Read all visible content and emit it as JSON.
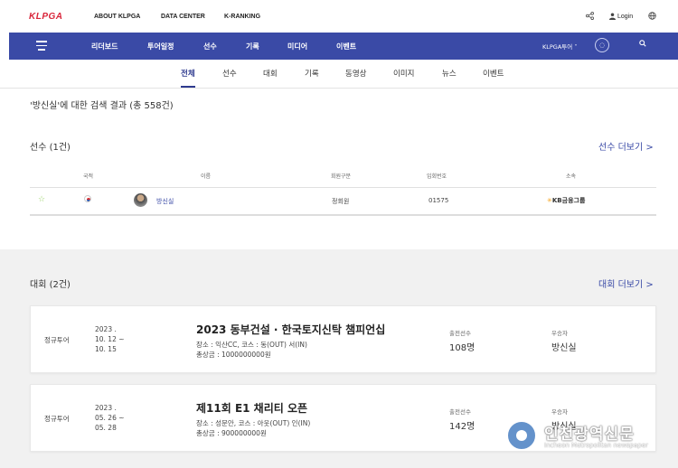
{
  "topbar": {
    "logo": "KLPGA",
    "links": [
      "ABOUT KLPGA",
      "DATA CENTER",
      "K-RANKING"
    ],
    "share_icon": "share-icon",
    "login_label": "Login",
    "globe_icon": "globe-icon"
  },
  "navbar": {
    "items": [
      "리더보드",
      "투어일정",
      "선수",
      "기록",
      "미디어",
      "이벤트"
    ],
    "tour_select": "KLPGA투어 ˅",
    "search_icon": "search-icon",
    "background": "#3a4aa6"
  },
  "subtabs": [
    "전체",
    "선수",
    "대회",
    "기록",
    "동영상",
    "이미지",
    "뉴스",
    "이벤트"
  ],
  "search_result": "'방신실'에 대한 검색 결과 (총 558건)",
  "players": {
    "title": "선수 (1건)",
    "more": "선수 더보기 >",
    "headers": [
      "국적",
      "이름",
      "회원구분",
      "입회번호",
      "소속"
    ],
    "rows": [
      {
        "name": "방신실",
        "member_type": "정회원",
        "member_no": "01575",
        "sponsor": "KB금융그룹"
      }
    ]
  },
  "tournaments": {
    "title": "대회 (2건)",
    "more": "대회 더보기 >",
    "cards": [
      {
        "type": "정규투어",
        "date": [
          "2023 .",
          "10. 12 ~",
          "10. 15"
        ],
        "name": "2023 동부건설 · 한국토지신탁 챔피언십",
        "course": "장소 : 익산CC, 코스 : 동(OUT) 서(IN)",
        "prize": "총상금 : 1000000000원",
        "players_label": "출전선수",
        "players": "108명",
        "winner_label": "우승자",
        "winner": "방신실"
      },
      {
        "type": "정규투어",
        "date": [
          "2023 .",
          "05. 26 ~",
          "05. 28"
        ],
        "name": "제11회 E1 채리티 오픈",
        "course": "장소 : 성문안, 코스 : 아웃(OUT) 인(IN)",
        "prize": "총상금 : 900000000원",
        "players_label": "출전선수",
        "players": "142명",
        "winner_label": "우승자",
        "winner": "방신실"
      }
    ]
  },
  "watermark": {
    "name": "인천광역신문",
    "sub": "Incheon Metropolitan newspaper"
  }
}
